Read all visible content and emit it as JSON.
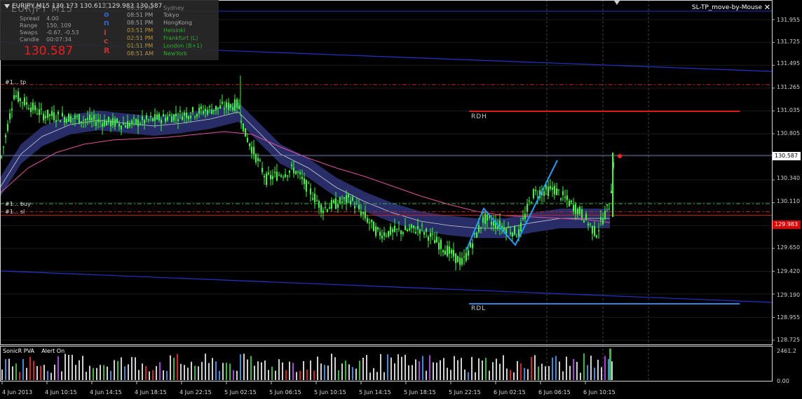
{
  "info": {
    "symbol_line": "EURJPY,M15  130.173 130.613 129.983 130.587",
    "ghost_title": "EURJPY M15",
    "rows": [
      {
        "label": "Spread",
        "value": "4.00"
      },
      {
        "label": "Range",
        "value": "150, 109"
      },
      {
        "label": "Swaps",
        "value": "-0.67, -0.53"
      },
      {
        "label": "Candle",
        "value": "00:07:34"
      }
    ],
    "price": "130.587"
  },
  "sessions": {
    "letters": [
      {
        "ch": "C",
        "color": "#5a5a5a"
      },
      {
        "ch": "o",
        "color": "#3a6adf"
      },
      {
        "ch": "n",
        "color": "#3a6adf"
      },
      {
        "ch": "i",
        "color": "#c84040"
      },
      {
        "ch": "c",
        "color": "#c84040"
      },
      {
        "ch": "R",
        "color": "#e03030"
      }
    ],
    "rows": [
      {
        "time": "09:51 PM",
        "name": "Sydney",
        "color": "#8a8a8a"
      },
      {
        "time": "08:51 PM",
        "name": "Tokyo",
        "color": "#b0b0b0"
      },
      {
        "time": "08:51 PM",
        "name": "HongKong",
        "color": "#b0b0b0"
      },
      {
        "time": "03:51 PM",
        "name": "Helsinki",
        "color": "#2fbf2f"
      },
      {
        "time": "02:51 PM",
        "name": "Frankfurt  (L)",
        "color": "#2fbf2f"
      },
      {
        "time": "01:51 PM",
        "name": "London  (B+1)",
        "color": "#2fbf2f"
      },
      {
        "time": "08:51 AM",
        "name": "NewYork",
        "color": "#2fbf2f"
      }
    ]
  },
  "ea": {
    "label": "SL-TP_move-by-Mouse"
  },
  "price_axis": {
    "ticks": [
      "131.955",
      "131.725",
      "131.495",
      "131.265",
      "131.035",
      "130.805",
      "130.575",
      "130.340",
      "130.110",
      "129.880",
      "129.650",
      "129.420",
      "129.190",
      "128.955",
      "128.725"
    ],
    "current": "130.587",
    "sl_tag": "129.983"
  },
  "lines": {
    "tp": "#1... tp",
    "buy": "#1... buy",
    "sl": "#1... sl",
    "rdh": "RDH",
    "rdl": "RDL"
  },
  "indicator": {
    "name": "SonicR PVA",
    "alert": "Alert On",
    "ticks": [
      "2461.2",
      "0.00"
    ]
  },
  "time_axis": [
    "4 Jun 2013",
    "4 Jun 10:15",
    "4 Jun 14:15",
    "4 Jun 18:15",
    "4 Jun 22:15",
    "5 Jun 02:15",
    "5 Jun 06:15",
    "5 Jun 10:15",
    "5 Jun 14:15",
    "5 Jun 18:15",
    "5 Jun 22:15",
    "6 Jun 02:15",
    "6 Jun 06:15",
    "6 Jun 10:15"
  ],
  "colors": {
    "candle": "#32ff32",
    "tp_line": "#d02020",
    "sl_line": "#d02020",
    "buy_line": "#3cb43c",
    "channel": "#2233cc",
    "rdh": "#e01818",
    "rdl": "#2a86e0",
    "ema_band": "#2a2f6e",
    "ma_pink": "#e050a0",
    "swing": "#1e9fff",
    "vol_default": "#d0d0d0",
    "vol_green": "#30c030",
    "vol_red": "#e02020",
    "vol_blue": "#3a8ee0",
    "vol_violet": "#b040e0"
  }
}
